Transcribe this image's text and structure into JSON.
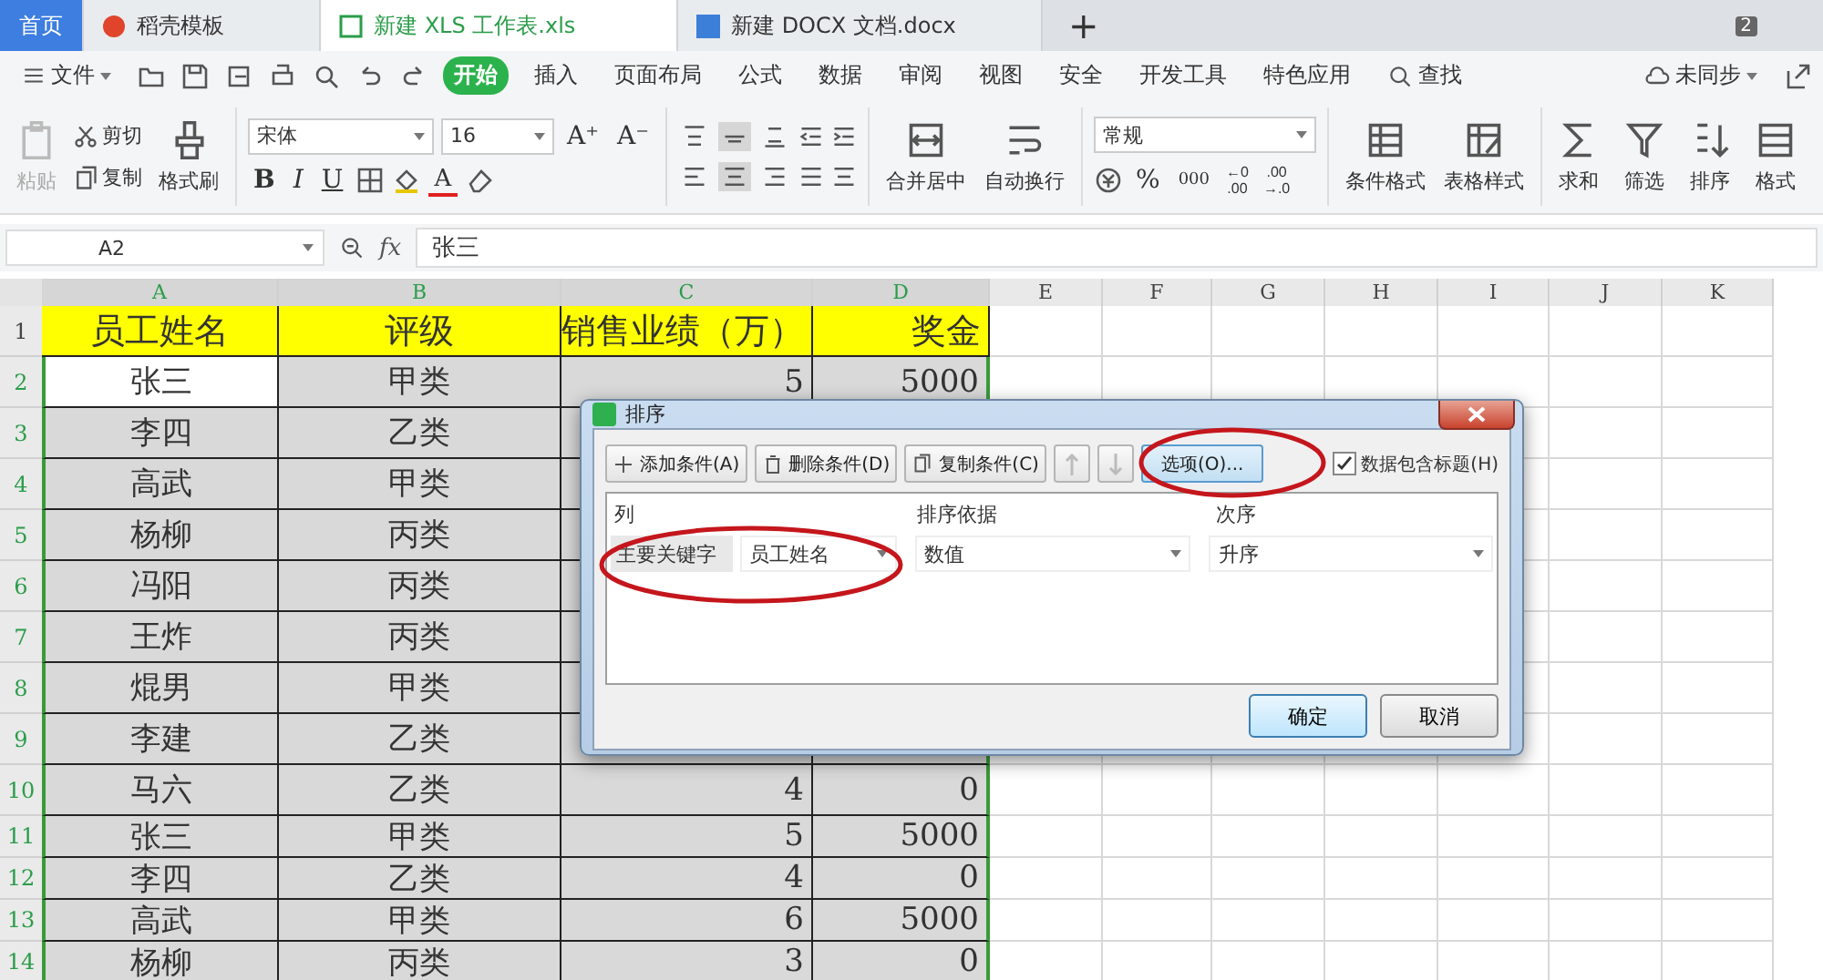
{
  "tabs": [
    {
      "label": "首页",
      "kind": "home",
      "selected": false
    },
    {
      "label": "稻壳模板",
      "kind": "docer",
      "selected": false
    },
    {
      "label": "新建 XLS 工作表.xls",
      "kind": "sheet",
      "selected": true
    },
    {
      "label": "新建 DOCX 文档.docx",
      "kind": "doc",
      "selected": false
    }
  ],
  "new_tab": "+",
  "window_count": "2",
  "menu": {
    "file": "文件",
    "items": [
      {
        "label": "开始",
        "selected": true
      },
      {
        "label": "插入",
        "selected": false
      },
      {
        "label": "页面布局",
        "selected": false
      },
      {
        "label": "公式",
        "selected": false
      },
      {
        "label": "数据",
        "selected": false
      },
      {
        "label": "审阅",
        "selected": false
      },
      {
        "label": "视图",
        "selected": false
      },
      {
        "label": "安全",
        "selected": false
      },
      {
        "label": "开发工具",
        "selected": false
      },
      {
        "label": "特色应用",
        "selected": false
      }
    ],
    "search": "查找",
    "sync": "未同步"
  },
  "ribbon": {
    "paste": {
      "label": "粘贴",
      "disabled": true
    },
    "cut": "剪切",
    "copy": "复制",
    "format_painter": "格式刷",
    "font_family": "宋体",
    "font_size": "16",
    "size_buttons": [
      "A⁺",
      "A⁻"
    ],
    "font_styles": [
      "B",
      "I",
      "U"
    ],
    "font_color_glyph": "A",
    "vertical_align": [
      {
        "selected": false
      },
      {
        "selected": true
      },
      {
        "selected": false
      }
    ],
    "horizontal_align": [
      {
        "selected": false
      },
      {
        "selected": true
      },
      {
        "selected": false
      }
    ],
    "merge": "合并居中",
    "wrap": "自动换行",
    "number_format": "常规",
    "percent": "%",
    "thousands": "000",
    "decimals": [
      {
        "top": "←0",
        "bottom": ".00"
      },
      {
        "top": ".00",
        "bottom": "→.0"
      }
    ],
    "conditional": "条件格式",
    "table_style": "表格样式",
    "sum": "求和",
    "filter": "筛选",
    "sort": "排序",
    "format": "格式"
  },
  "formula_bar": {
    "name_box": "A2",
    "function_label": "fx",
    "value": "张三"
  },
  "columns": [
    {
      "label": "A",
      "highlighted": true
    },
    {
      "label": "B",
      "highlighted": true
    },
    {
      "label": "C",
      "highlighted": true
    },
    {
      "label": "D",
      "highlighted": true
    },
    {
      "label": "E",
      "highlighted": false
    },
    {
      "label": "F",
      "highlighted": false
    },
    {
      "label": "G",
      "highlighted": false
    },
    {
      "label": "H",
      "highlighted": false
    },
    {
      "label": "I",
      "highlighted": false
    },
    {
      "label": "J",
      "highlighted": false
    },
    {
      "label": "K",
      "highlighted": false
    }
  ],
  "rows": [
    {
      "number": "1",
      "kind": "heading",
      "highlighted": false,
      "cells": [
        {
          "text": "员工姓名",
          "selected": false
        },
        {
          "text": "评级",
          "selected": false
        },
        {
          "text": "销售业绩（万）",
          "selected": false
        },
        {
          "text": "奖金",
          "selected": false
        }
      ]
    },
    {
      "number": "2",
      "kind": "data",
      "highlighted": true,
      "cells": [
        {
          "text": "张三",
          "selected": true
        },
        {
          "text": "甲类",
          "selected": false
        },
        {
          "text": "5",
          "selected": false
        },
        {
          "text": "5000",
          "selected": false
        }
      ]
    },
    {
      "number": "3",
      "kind": "data",
      "highlighted": true,
      "cells": [
        {
          "text": "李四",
          "selected": false
        },
        {
          "text": "乙类",
          "selected": false
        }
      ]
    },
    {
      "number": "4",
      "kind": "data",
      "highlighted": true,
      "cells": [
        {
          "text": "高武",
          "selected": false
        },
        {
          "text": "甲类",
          "selected": false
        }
      ]
    },
    {
      "number": "5",
      "kind": "data",
      "highlighted": true,
      "cells": [
        {
          "text": "杨柳",
          "selected": false
        },
        {
          "text": "丙类",
          "selected": false
        }
      ]
    },
    {
      "number": "6",
      "kind": "data",
      "highlighted": true,
      "cells": [
        {
          "text": "冯阳",
          "selected": false
        },
        {
          "text": "丙类",
          "selected": false
        }
      ]
    },
    {
      "number": "7",
      "kind": "data",
      "highlighted": true,
      "cells": [
        {
          "text": "王炸",
          "selected": false
        },
        {
          "text": "丙类",
          "selected": false
        }
      ]
    },
    {
      "number": "8",
      "kind": "data",
      "highlighted": true,
      "cells": [
        {
          "text": "焜男",
          "selected": false
        },
        {
          "text": "甲类",
          "selected": false
        }
      ]
    },
    {
      "number": "9",
      "kind": "data",
      "highlighted": true,
      "cells": [
        {
          "text": "李建",
          "selected": false
        },
        {
          "text": "乙类",
          "selected": false
        }
      ]
    },
    {
      "number": "10",
      "kind": "data",
      "highlighted": true,
      "cells": [
        {
          "text": "马六",
          "selected": false
        },
        {
          "text": "乙类",
          "selected": false
        },
        {
          "text": "4",
          "selected": false
        },
        {
          "text": "0",
          "selected": false
        }
      ]
    },
    {
      "number": "11",
      "kind": "data",
      "highlighted": true,
      "cells": [
        {
          "text": "张三",
          "selected": false
        },
        {
          "text": "甲类",
          "selected": false
        },
        {
          "text": "5",
          "selected": false
        },
        {
          "text": "5000",
          "selected": false
        }
      ]
    },
    {
      "number": "12",
      "kind": "data",
      "highlighted": true,
      "cells": [
        {
          "text": "李四",
          "selected": false
        },
        {
          "text": "乙类",
          "selected": false
        },
        {
          "text": "4",
          "selected": false
        },
        {
          "text": "0",
          "selected": false
        }
      ]
    },
    {
      "number": "13",
      "kind": "data",
      "highlighted": true,
      "cells": [
        {
          "text": "高武",
          "selected": false
        },
        {
          "text": "甲类",
          "selected": false
        },
        {
          "text": "6",
          "selected": false
        },
        {
          "text": "5000",
          "selected": false
        }
      ]
    },
    {
      "number": "14",
      "kind": "data",
      "highlighted": true,
      "cells": [
        {
          "text": "杨柳",
          "selected": false
        },
        {
          "text": "丙类",
          "selected": false
        },
        {
          "text": "3",
          "selected": false
        },
        {
          "text": "0",
          "selected": false
        }
      ]
    }
  ],
  "dialog": {
    "title": "排序",
    "toolbar": [
      {
        "label": "添加条件(A)",
        "kind": "add"
      },
      {
        "label": "删除条件(D)",
        "kind": "delete"
      },
      {
        "label": "复制条件(C)",
        "kind": "copy"
      }
    ],
    "move_up": {
      "disabled": true
    },
    "move_down": {
      "disabled": true
    },
    "options": "选项(O)...",
    "has_header": {
      "label": "数据包含标题(H)",
      "checked": true
    },
    "headers": [
      "列",
      "排序依据",
      "次序"
    ],
    "condition": {
      "label": "主要关键字",
      "column": "员工姓名",
      "sort_on": "数值",
      "order": "升序"
    },
    "ok": "确定",
    "cancel": "取消"
  },
  "annotations": [
    {
      "kind": "ellipse"
    },
    {
      "kind": "ellipse"
    }
  ]
}
